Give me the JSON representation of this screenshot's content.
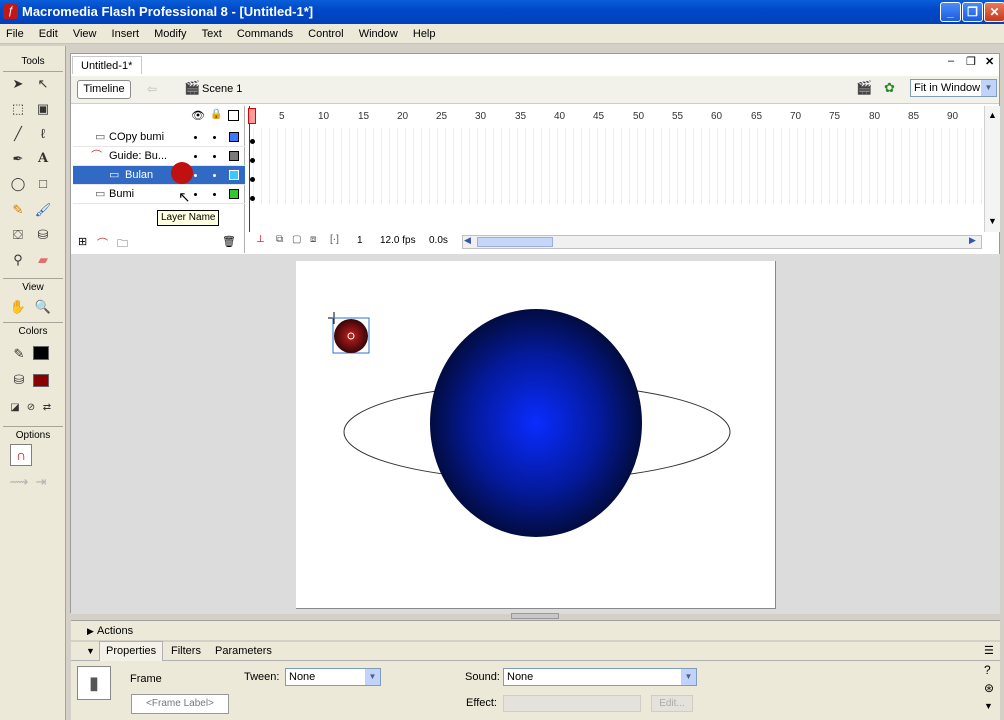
{
  "window": {
    "title": "Macromedia Flash Professional 8 - [Untitled-1*]",
    "min": "_",
    "max": "❐",
    "close": "✕"
  },
  "menu": [
    "File",
    "Edit",
    "View",
    "Insert",
    "Modify",
    "Text",
    "Commands",
    "Control",
    "Window",
    "Help"
  ],
  "tools": {
    "title": "Tools",
    "view_label": "View",
    "colors_label": "Colors",
    "options_label": "Options"
  },
  "document": {
    "tab": "Untitled-1*",
    "timeline_button": "Timeline",
    "scene": "Scene 1",
    "zoom": "Fit in Window"
  },
  "timeline": {
    "frame_numbers": [
      "5",
      "10",
      "15",
      "20",
      "25",
      "30",
      "35",
      "40",
      "45",
      "50",
      "55",
      "60",
      "65",
      "70",
      "75",
      "80",
      "85",
      "90"
    ],
    "layers": [
      {
        "name": "COpy bumi",
        "color": "#3c78ff"
      },
      {
        "name": "Guide: Bu...",
        "color": "#7a7a7a"
      },
      {
        "name": "Bulan",
        "color": "#3cc8ff",
        "selected": true
      },
      {
        "name": "Bumi",
        "color": "#32c832"
      }
    ],
    "current_frame": "1",
    "fps": "12.0 fps",
    "time": "0.0s",
    "tooltip": "Layer Name"
  },
  "panels": {
    "actions": "Actions",
    "tabs": [
      "Properties",
      "Filters",
      "Parameters"
    ],
    "frame_label": "Frame",
    "frame_label_placeholder": "<Frame Label>",
    "tween_label": "Tween:",
    "tween_value": "None",
    "sound_label": "Sound:",
    "sound_value": "None",
    "effect_label": "Effect:",
    "edit_button": "Edit..."
  },
  "colors": {
    "selection": "#316ac5",
    "fill_black": "#000000",
    "fill_red": "#8b0000"
  }
}
